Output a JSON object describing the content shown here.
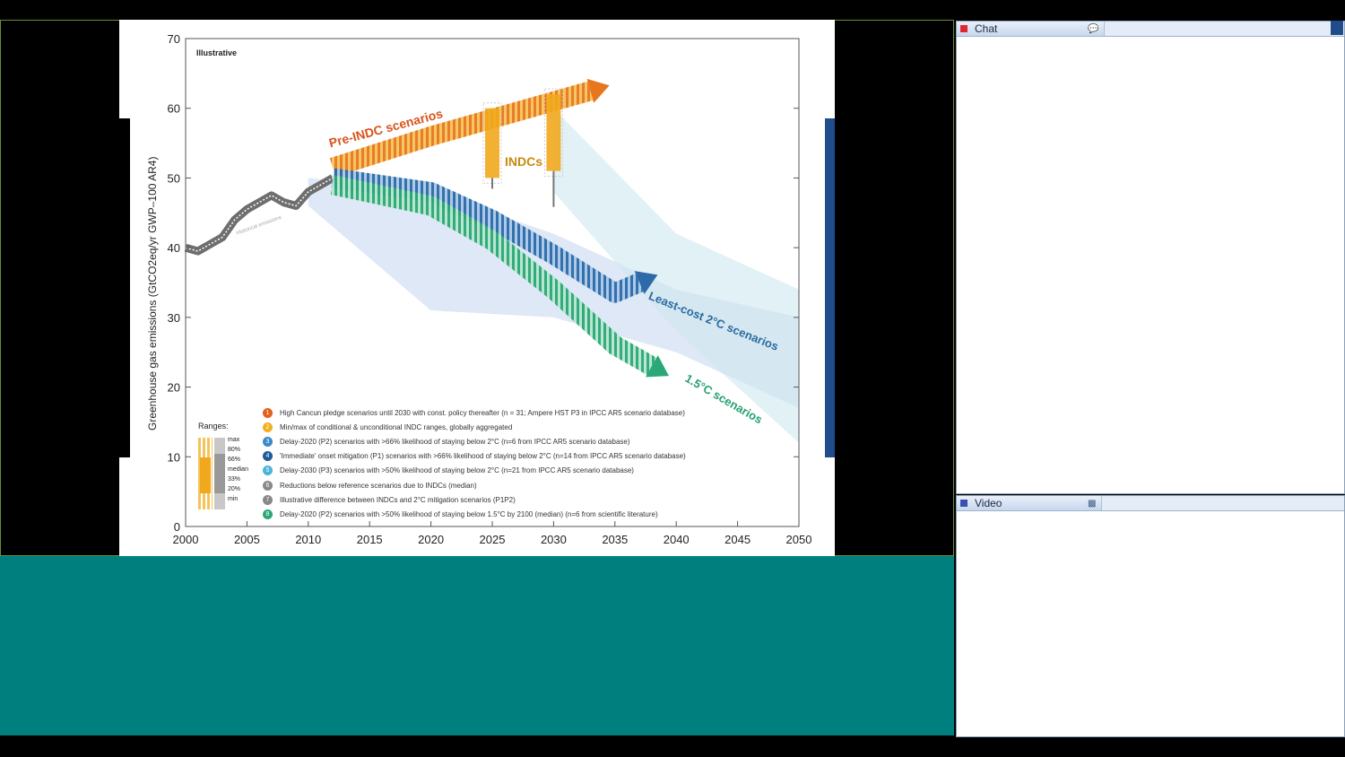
{
  "chat_panel": {
    "title": "Chat",
    "status_color": "#e2262f",
    "icon": "speech-bubble-icon"
  },
  "video_panel": {
    "title": "Video",
    "status_color": "#3a4fb0",
    "icon": "camera-icon"
  },
  "slide": {
    "corner_label": "Illustrative",
    "ranges_label": "Ranges:",
    "range_keys": [
      "max",
      "80%",
      "66%",
      "median",
      "33%",
      "20%",
      "min"
    ],
    "labels": {
      "pre_indc": "Pre-INDC scenarios",
      "indcs": "INDCs",
      "least_cost": "Least-cost 2°C scenarios",
      "one_five": "1.5°C scenarios",
      "hist": "Historical emissions"
    },
    "legend": [
      {
        "num": "1",
        "color": "#e4601e",
        "text": "High Cancun pledge scenarios until 2030 with const. policy thereafter (n = 31; Ampere HST P3 in IPCC AR5 scenario database)"
      },
      {
        "num": "2",
        "color": "#f2b020",
        "text": "Min/max of conditional & unconditional INDC ranges, globally aggregated"
      },
      {
        "num": "3",
        "color": "#3a88c8",
        "text": "Delay-2020 (P2) scenarios with >66% likelihood of staying below 2°C (n=6 from IPCC AR5 scenario database)"
      },
      {
        "num": "4",
        "color": "#1f5a9a",
        "text": "'Immediate' onset mitigation (P1) scenarios with >66% likelihood of staying below 2°C (n=14 from IPCC AR5 scenario database)"
      },
      {
        "num": "5",
        "color": "#4ab4d8",
        "text": "Delay-2030 (P3) scenarios with >50% likelihood of staying below 2°C (n=21 from IPCC AR5 scenario database)"
      },
      {
        "num": "6",
        "color": "#888888",
        "text": "Reductions below reference scenarios due to INDCs (median)"
      },
      {
        "num": "7",
        "color": "#888888",
        "text": "Illustrative difference between INDCs and 2°C mitigation scenarios (P1P2)"
      },
      {
        "num": "8",
        "color": "#2aa878",
        "text": "Delay-2020 (P2) scenarios with >50% likelihood of staying below 1.5°C by 2100 (median) (n=6 from scientific literature)"
      }
    ]
  },
  "chart_data": {
    "type": "line",
    "title": "",
    "xlabel": "",
    "ylabel": "Greenhouse gas emissions (GtCO2eq/yr GWP–100 AR4)",
    "xlim": [
      2000,
      2050
    ],
    "ylim": [
      0,
      70
    ],
    "x_ticks": [
      2000,
      2005,
      2010,
      2015,
      2020,
      2025,
      2030,
      2035,
      2040,
      2045,
      2050
    ],
    "y_ticks": [
      0,
      10,
      20,
      30,
      40,
      50,
      60,
      70
    ],
    "grid": false,
    "series": [
      {
        "name": "",
        "x": [
          2000,
          2001,
          2002,
          2003,
          2004,
          2005,
          2006,
          2007,
          2008,
          2009,
          2010,
          2011,
          2012
        ],
        "y": [
          40,
          39.5,
          40.5,
          41.5,
          44,
          45.5,
          46.5,
          47.5,
          46.5,
          46,
          48,
          49,
          50
        ]
      },
      {
        "name": "Pre-INDC scenarios",
        "x": [
          2012,
          2020,
          2025,
          2030,
          2033
        ],
        "y": [
          51.5,
          56,
          58.5,
          61,
          62.5
        ]
      },
      {
        "name": "Least-cost 2°C scenarios",
        "x": [
          2012,
          2020,
          2025,
          2030,
          2035,
          2037
        ],
        "y": [
          50,
          48,
          44,
          39,
          33.5,
          35
        ]
      },
      {
        "name": "1.5°C scenarios",
        "x": [
          2012,
          2020,
          2025,
          2030,
          2035,
          2038
        ],
        "y": [
          49,
          46,
          41,
          34,
          26,
          23
        ]
      }
    ],
    "ranges": [
      {
        "name": "INDCs 2025",
        "x": 2025,
        "min": 50,
        "max": 60
      },
      {
        "name": "INDCs 2030",
        "x": 2030,
        "min": 51,
        "max": 62
      }
    ]
  }
}
